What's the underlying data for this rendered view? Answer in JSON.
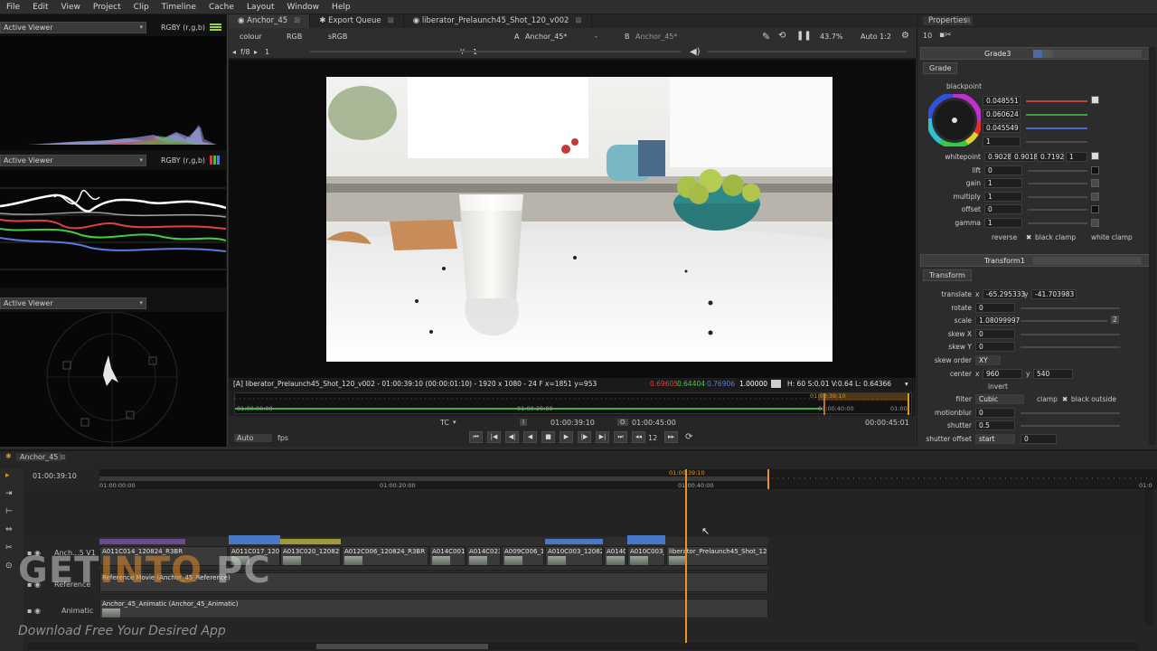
{
  "menu": [
    "File",
    "Edit",
    "View",
    "Project",
    "Clip",
    "Timeline",
    "Cache",
    "Layout",
    "Window",
    "Help"
  ],
  "left_panel": {
    "viewer_select_1": "Active Viewer",
    "rgby_1": "RGBY (r,g,b)",
    "viewer_select_2": "Active Viewer",
    "rgby_2": "RGBY (r,g,b)",
    "viewer_select_3": "Active Viewer"
  },
  "viewer": {
    "tabs": [
      {
        "label": "Anchor_45",
        "close": "⊠"
      },
      {
        "label": "Export Queue",
        "close": "⊠"
      },
      {
        "label": "liberator_Prelaunch45_Shot_120_v002",
        "close": "⊠"
      }
    ],
    "toolbar": {
      "colour": "colour",
      "channels": "RGB",
      "lut": "sRGB",
      "input_a_label": "A",
      "input_a": "Anchor_45*",
      "wipe": "-",
      "input_b_label": "B",
      "input_b": "Anchor_45*",
      "zoom": "43.7%",
      "proxy": "Auto 1:2",
      "frame_range": "f/8",
      "frame_value": "1",
      "y_label": "Y",
      "y_value": "1"
    },
    "info": {
      "left": "[A] liberator_Prelaunch45_Shot_120_v002 - 01:00:39:10 (00:00:01:10) - 1920 x 1080 - 24 F  x=1851 y=953",
      "r": "0.69605",
      "g": "0.64404",
      "b": "0.76906",
      "a": "1.00000",
      "hsvl": "H: 60 S:0.01 V:0.64  L: 0.64366"
    },
    "scrub": {
      "t_start": "01:00:00:00",
      "t_mid": "01:00:20:00",
      "t_mark": "01:00:40:00",
      "t_end": "01:00:",
      "t_playhead": "01:00:39:10"
    },
    "transport": {
      "auto": "Auto",
      "fps": "fps",
      "tc": "TC",
      "in_marker": "I",
      "current": "01:00:39:10",
      "out_marker": "O",
      "out": "01:00:45:00",
      "duration": "00:00:45:01",
      "step": "12"
    }
  },
  "properties": {
    "title": "Properties",
    "max_panels": "10",
    "grade_node": "Grade3",
    "grade_tab": "Grade",
    "blackpoint_label": "blackpoint",
    "blackpoint": [
      "0.048551",
      "0.060624",
      "0.045549",
      "1"
    ],
    "whitepoint_label": "whitepoint",
    "whitepoint": [
      "0.9028",
      "0.9018",
      "0.7192",
      "1"
    ],
    "lift_label": "lift",
    "lift": "0",
    "gain_label": "gain",
    "gain": "1",
    "multiply_label": "multiply",
    "multiply": "1",
    "offset_label": "offset",
    "offset": "0",
    "gamma_label": "gamma",
    "gamma": "1",
    "reverse": "reverse",
    "black_clamp": "black clamp",
    "white_clamp": "white clamp",
    "transform_node": "Transform1",
    "transform_tab": "Transform",
    "translate_label": "translate",
    "translate_x_label": "x",
    "translate_x": "-65.295333",
    "translate_y_label": "y",
    "translate_y": "-41.703983",
    "rotate_label": "rotate",
    "rotate": "0",
    "scale_label": "scale",
    "scale": "1.08099997",
    "scale_btn": "2",
    "skewx_label": "skew X",
    "skewx": "0",
    "skewy_label": "skew Y",
    "skewy": "0",
    "skew_order_label": "skew order",
    "skew_order": "XY",
    "center_label": "center",
    "center_x_label": "x",
    "center_x": "960",
    "center_y_label": "y",
    "center_y": "540",
    "invert": "invert",
    "filter_label": "filter",
    "filter": "Cubic",
    "clamp": "clamp",
    "black_outside": "black outside",
    "motionblur_label": "motionblur",
    "motionblur": "0",
    "shutter_label": "shutter",
    "shutter": "0.5",
    "shutter_offset_label": "shutter offset",
    "shutter_offset": "start",
    "shutter_offset_val": "0"
  },
  "timeline": {
    "tab": "Anchor_45",
    "timecode": "01:00:39:10",
    "ruler": {
      "t0": "01:00:00:00",
      "t1": "01:00:20:00",
      "t2": "01:00:40:00",
      "t3": "01:0"
    },
    "playhead": "01:00:39:10",
    "tracks": [
      {
        "name": "Anch...5 V1"
      },
      {
        "name": "Reference"
      },
      {
        "name": "Animatic"
      }
    ],
    "clips_v1": [
      {
        "label": "A011C014_120824_R3BR"
      },
      {
        "label": "A011C022_12"
      },
      {
        "label": "A011C017_1208"
      },
      {
        "label": "A013C020_120825"
      },
      {
        "label": "A012C006_120824_R3BR"
      },
      {
        "label": "A014C001"
      },
      {
        "label": "A014C023"
      },
      {
        "label": "A009C006_12"
      },
      {
        "label": "A010C003_120823"
      },
      {
        "label": "A014C"
      },
      {
        "label": "A010C003_1"
      },
      {
        "label": "liberator_Prelaunch45_Shot_120"
      }
    ],
    "reference_clip": "Reference Movie (Anchor_45_Reference)",
    "animatic_clip": "Anchor_45_Animatic (Anchor_45_Animatic)"
  },
  "watermark": {
    "get": "GET",
    "into": "INTO",
    "pc": " PC",
    "tagline": "Download Free Your Desired App"
  },
  "colors": {
    "accent_orange": "#e88a1a",
    "playhead": "#e8941e",
    "clip_blue": "#4a78c8",
    "clip_purple": "#6a4a8a"
  }
}
